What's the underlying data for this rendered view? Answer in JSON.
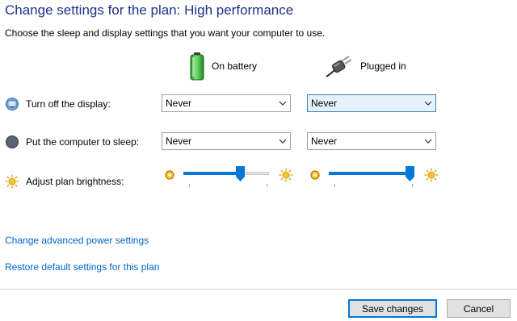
{
  "header": {
    "title": "Change settings for the plan: High performance",
    "subtitle": "Choose the sleep and display settings that you want your computer to use."
  },
  "columns": {
    "battery": {
      "label": "On battery",
      "icon": "battery-icon"
    },
    "plugged": {
      "label": "Plugged in",
      "icon": "power-plug-icon"
    }
  },
  "rows": {
    "display": {
      "label": "Turn off the display:",
      "icon": "display-icon",
      "battery_value": "Never",
      "plugged_value": "Never"
    },
    "sleep": {
      "label": "Put the computer to sleep:",
      "icon": "sleep-moon-icon",
      "battery_value": "Never",
      "plugged_value": "Never"
    },
    "brightness": {
      "label": "Adjust plan brightness:",
      "icon": "brightness-sun-icon",
      "battery_level_percent": 68,
      "plugged_level_percent": 100
    }
  },
  "links": {
    "advanced": "Change advanced power settings",
    "restore": "Restore default settings for this plan"
  },
  "buttons": {
    "save": "Save changes",
    "cancel": "Cancel"
  },
  "colors": {
    "title": "#1e3287",
    "link": "#0066cc",
    "accent": "#0078d7",
    "battery_green": "#3cb53c",
    "focused_select_bg": "#e5f1fb"
  }
}
